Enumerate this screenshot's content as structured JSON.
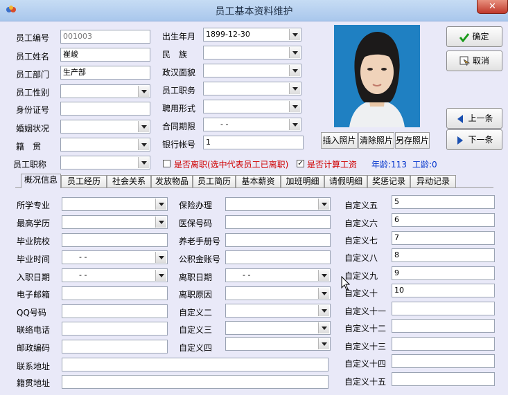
{
  "window": {
    "title": "员工基本资料维护",
    "close": "✕"
  },
  "basic": {
    "employee_no": {
      "label": "员工编号",
      "value": "001003"
    },
    "name": {
      "label": "员工姓名",
      "value": "崔峻"
    },
    "department": {
      "label": "员工部门",
      "value": "生产部"
    },
    "gender": {
      "label": "员工性别",
      "value": ""
    },
    "id_no": {
      "label": "身份证号",
      "value": ""
    },
    "marital": {
      "label": "婚姻状况",
      "value": ""
    },
    "native_place": {
      "label": "籍　贯",
      "value": ""
    },
    "title": {
      "label": "员工职称",
      "value": ""
    },
    "birth": {
      "label": "出生年月",
      "value": "1899-12-30"
    },
    "ethnicity": {
      "label": "民　族",
      "value": ""
    },
    "political": {
      "label": "政汉面貌",
      "value": ""
    },
    "position": {
      "label": "员工职务",
      "value": ""
    },
    "hire_form": {
      "label": "聘用形式",
      "value": ""
    },
    "contract_term": {
      "label": "合同期限",
      "value": " -  -"
    },
    "bank_account": {
      "label": "银行帐号",
      "value": "1"
    }
  },
  "buttons": {
    "ok": "确定",
    "cancel": "取消",
    "prev": "上一条",
    "next": "下一条",
    "insert_photo": "插入照片",
    "clear_photo": "清除照片",
    "save_photo": "另存照片"
  },
  "status": {
    "resigned_label": "是否离职(选中代表员工已离职)",
    "resigned_checked": false,
    "payroll_label": "是否计算工资",
    "payroll_checked": true,
    "age": "年龄:113",
    "seniority": "工龄:0"
  },
  "tabs": [
    "概况信息",
    "员工经历",
    "社会关系",
    "发放物品",
    "员工简历",
    "基本薪资",
    "加班明细",
    "请假明细",
    "奖惩记录",
    "异动记录"
  ],
  "active_tab": 0,
  "details": {
    "major": {
      "label": "所学专业",
      "value": ""
    },
    "education": {
      "label": "最高学历",
      "value": ""
    },
    "school": {
      "label": "毕业院校",
      "value": ""
    },
    "grad_time": {
      "label": "毕业时间",
      "value": " -  -"
    },
    "entry_date": {
      "label": "入职日期",
      "value": " -  -"
    },
    "email": {
      "label": "电子邮箱",
      "value": ""
    },
    "qq": {
      "label": "QQ号码",
      "value": ""
    },
    "phone": {
      "label": "联络电话",
      "value": ""
    },
    "postcode": {
      "label": "邮政编码",
      "value": ""
    },
    "address": {
      "label": "联系地址",
      "value": ""
    },
    "native_address": {
      "label": "籍贯地址",
      "value": ""
    },
    "insurance": {
      "label": "保险办理",
      "value": ""
    },
    "medical_no": {
      "label": "医保号码",
      "value": ""
    },
    "pension_no": {
      "label": "养老手册号",
      "value": ""
    },
    "fund_no": {
      "label": "公积金账号",
      "value": ""
    },
    "leave_date": {
      "label": "离职日期",
      "value": " -  -"
    },
    "leave_reason": {
      "label": "离职原因",
      "value": ""
    },
    "custom2": {
      "label": "自定义二",
      "value": ""
    },
    "custom3": {
      "label": "自定义三",
      "value": ""
    },
    "custom4": {
      "label": "自定义四",
      "value": ""
    },
    "custom5": {
      "label": "自定义五",
      "value": "5"
    },
    "custom6": {
      "label": "自定义六",
      "value": "6"
    },
    "custom7": {
      "label": "自定义七",
      "value": "7"
    },
    "custom8": {
      "label": "自定义八",
      "value": "8"
    },
    "custom9": {
      "label": "自定义九",
      "value": "9"
    },
    "custom10": {
      "label": "自定义十",
      "value": "10"
    },
    "custom11": {
      "label": "自定义十一",
      "value": ""
    },
    "custom12": {
      "label": "自定义十二",
      "value": ""
    },
    "custom13": {
      "label": "自定义十三",
      "value": ""
    },
    "custom14": {
      "label": "自定义十四",
      "value": ""
    },
    "custom15": {
      "label": "自定义十五",
      "value": ""
    }
  }
}
